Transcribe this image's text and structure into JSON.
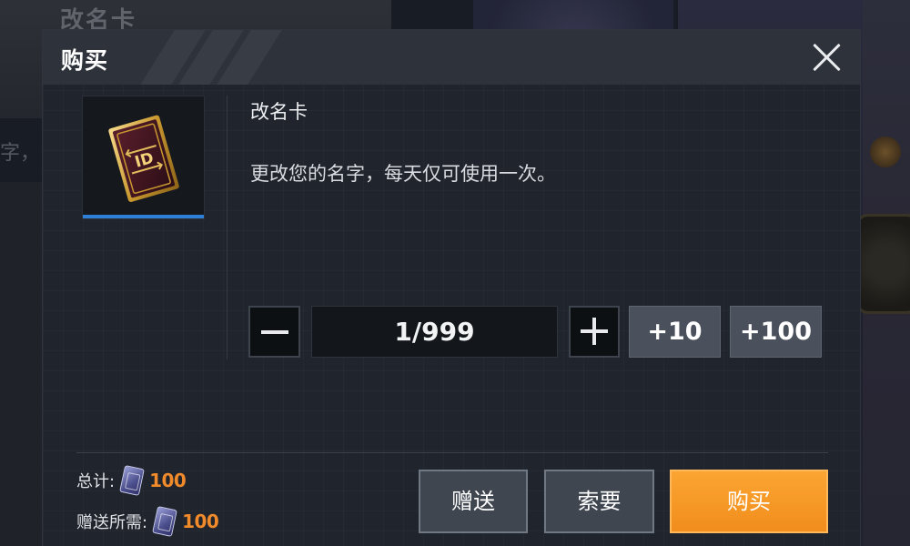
{
  "background": {
    "top_left_text": "改名卡",
    "left_text": "字，"
  },
  "dialog": {
    "title": "购买",
    "close_icon": "close-icon"
  },
  "item": {
    "icon": "id-card-icon",
    "icon_label": "ID",
    "name": "改名卡",
    "description": "更改您的名字，每天仅可使用一次。"
  },
  "quantity": {
    "display": "1/999",
    "minus_icon": "minus-icon",
    "plus_icon": "plus-icon",
    "step_10_label": "+10",
    "step_100_label": "+100"
  },
  "cost": {
    "total_label": "总计:",
    "total_value": "100",
    "gift_label": "赠送所需:",
    "gift_value": "100",
    "currency_icon": "voucher-icon",
    "value_color": "#f08a2a"
  },
  "actions": {
    "gift_label": "赠送",
    "request_label": "索要",
    "buy_label": "购买",
    "buy_color": "#f79a26"
  }
}
